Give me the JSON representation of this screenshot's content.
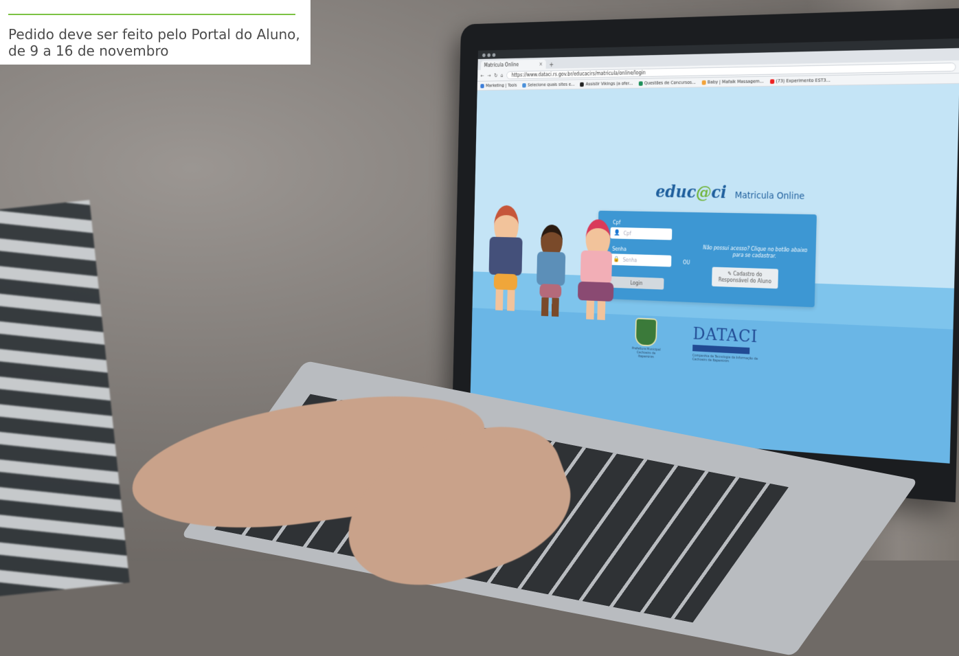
{
  "caption": {
    "text": "Pedido deve ser feito pelo Portal do Aluno, de 9 a 16 de novembro",
    "accent_color": "#7cc243"
  },
  "browser": {
    "tab_title": "Matrícula Online",
    "url": "https://www.dataci.rs.gov.br/educacirs/matricula/online/login",
    "bookmarks": [
      "Marketing | Tools",
      "Selecione quais sites e...",
      "Assistir Vikings (a ofer...",
      "Questões de Concursos...",
      "Baby | Mafalk Massagem...",
      "(73) Experimento EST3..."
    ]
  },
  "page": {
    "logo_text_pre": "educ",
    "logo_text_at": "@",
    "logo_text_post": "ci",
    "title": "Matricula Online",
    "cpf_label": "Cpf",
    "cpf_placeholder": "Cpf",
    "senha_label": "Senha",
    "senha_placeholder": "Senha",
    "login_button": "Login",
    "or_text": "OU",
    "signup_message": "Não possui acesso? Clique no botão abaixo para se cadastrar.",
    "signup_button_line1": "Cadastro do",
    "signup_button_line2": "Responsável do Aluno",
    "crest_caption": "Prefeitura Municipal Cachoeiro de Itapemirim",
    "dataci_logo": "DATACI",
    "dataci_caption": "Companhia de Tecnologia da Informação de Cachoeiro de Itapemirim"
  },
  "icons": {
    "user": "user-icon",
    "lock": "lock-icon",
    "edit": "edit-icon"
  }
}
